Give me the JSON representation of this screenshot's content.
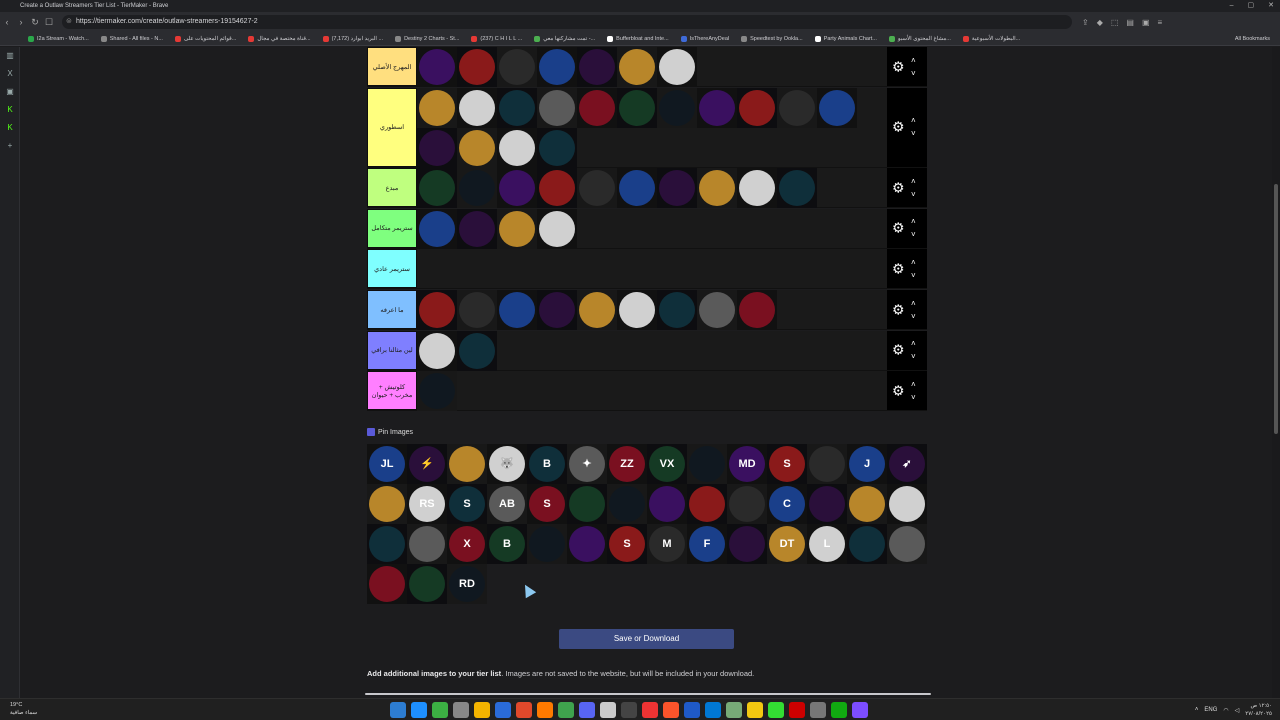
{
  "window": {
    "title": "Create a Outlaw Streamers Tier List - TierMaker - Brave",
    "controls": [
      "–",
      "▢",
      "✕"
    ]
  },
  "address": {
    "url": "https://tiermaker.com/create/outlaw-streamers-19154627-2"
  },
  "bookmarks": {
    "items": [
      {
        "label": "I2a Stream - Watch...",
        "color": "#2aa84a"
      },
      {
        "label": "Shared - All files - N...",
        "color": "#888888"
      },
      {
        "label": "قوائم المحتويات على...",
        "color": "#e53935"
      },
      {
        "label": "قناة مختصة في مجال...",
        "color": "#e53935"
      },
      {
        "label": "(7,172) البريد ابوارد ...",
        "color": "#e53935"
      },
      {
        "label": "Destiny 2 Charts - St...",
        "color": "#888888"
      },
      {
        "label": "(237) C H I L L ...",
        "color": "#e53935"
      },
      {
        "label": "تمت مشاركتها معي -...",
        "color": "#4caf50"
      },
      {
        "label": "Bufferbloat and Inte...",
        "color": "#ffffff"
      },
      {
        "label": "IsThereAnyDeal",
        "color": "#3f6bd8"
      },
      {
        "label": "Speedtest by Ookla...",
        "color": "#888888"
      },
      {
        "label": "Party Animals Chart...",
        "color": "#ffffff"
      },
      {
        "label": "مشاغ المحتوى الأسبو...",
        "color": "#4caf50"
      },
      {
        "label": "البطولات الأسبوعية...",
        "color": "#e53935"
      }
    ],
    "all_bookmarks": "All Bookmarks"
  },
  "tiers": [
    {
      "label": "المهرج الأصلي",
      "color": "#ffdf7f",
      "items": 7
    },
    {
      "label": "اسطوري",
      "color": "#ffff7f",
      "items": 15
    },
    {
      "label": "مبدع",
      "color": "#bfff7f",
      "items": 10
    },
    {
      "label": "ستريمر متكامل",
      "color": "#7fff7f",
      "items": 4
    },
    {
      "label": "ستريمر عادي",
      "color": "#7fffff",
      "items": 0
    },
    {
      "label": "ما اعرفه",
      "color": "#7fbfff",
      "items": 9
    },
    {
      "label": "لين مثالنا برافي",
      "color": "#7f7fff",
      "items": 2
    },
    {
      "label": "كلوتيش + مخرب + حيوان",
      "color": "#ff7fff",
      "items": 1
    }
  ],
  "pin_images": {
    "label": "Pin Images"
  },
  "pool_glyphs": [
    "JL",
    "⚡",
    "",
    "🐺",
    "B",
    "✦",
    "ZZ",
    "VX",
    "",
    "MD",
    "S",
    "",
    "J",
    "➶",
    "",
    "RS",
    "S",
    "AB",
    "S",
    "",
    "",
    "",
    "",
    "",
    "C",
    "",
    "",
    "",
    "",
    "",
    "X",
    "B",
    "",
    "",
    "S",
    "M",
    "F",
    "",
    "DT",
    "L",
    "",
    "",
    "",
    "",
    "RD"
  ],
  "save_button": "Save or Download",
  "add_images": {
    "bold": "Add additional images to your tier list",
    "rest": ". Images are not saved to the website, but will be included in your download."
  },
  "taskbar": {
    "weather_temp": "19°C",
    "weather_desc": "سماء صافية",
    "lang": "ENG",
    "time": "١٢:٥٠ ص",
    "date": "٢٧/٠٨/٢٠٢٥"
  },
  "colors": {
    "save_button": "#3b4a82",
    "tier_control_bg": "#000000"
  }
}
